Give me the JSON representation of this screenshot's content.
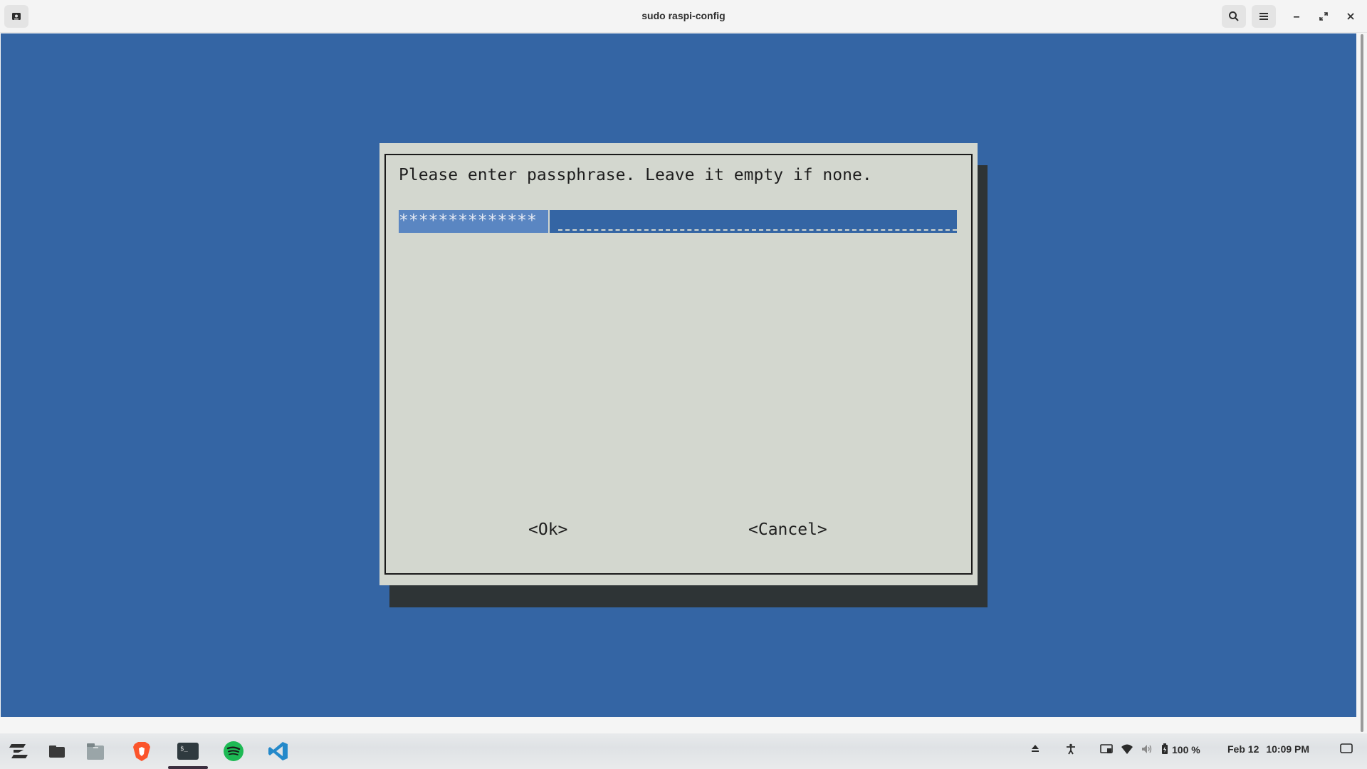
{
  "window": {
    "title": "sudo raspi-config"
  },
  "dialog": {
    "prompt": "Please enter passphrase. Leave it empty if none.",
    "passphrase_masked": "**************",
    "ok_label": "<Ok>",
    "cancel_label": "<Cancel>"
  },
  "taskbar": {
    "battery_percent": "100 %",
    "date": "Feb 12",
    "time": "10:09 PM"
  },
  "colors": {
    "terminal_bg": "#3465a4",
    "dialog_bg": "#d3d7cf",
    "shadow": "#2e3436",
    "field_selection": "#5a86c2"
  },
  "icons": [
    "app-icon",
    "search-icon",
    "menu-icon",
    "minimize-icon",
    "maximize-icon",
    "close-icon",
    "zorin-menu-icon",
    "files-icon",
    "folder-icon",
    "brave-icon",
    "terminal-icon",
    "spotify-icon",
    "vscode-icon",
    "eject-icon",
    "accessibility-icon",
    "screen-cast-icon",
    "wifi-icon",
    "volume-icon",
    "battery-icon",
    "desktop-icon"
  ]
}
